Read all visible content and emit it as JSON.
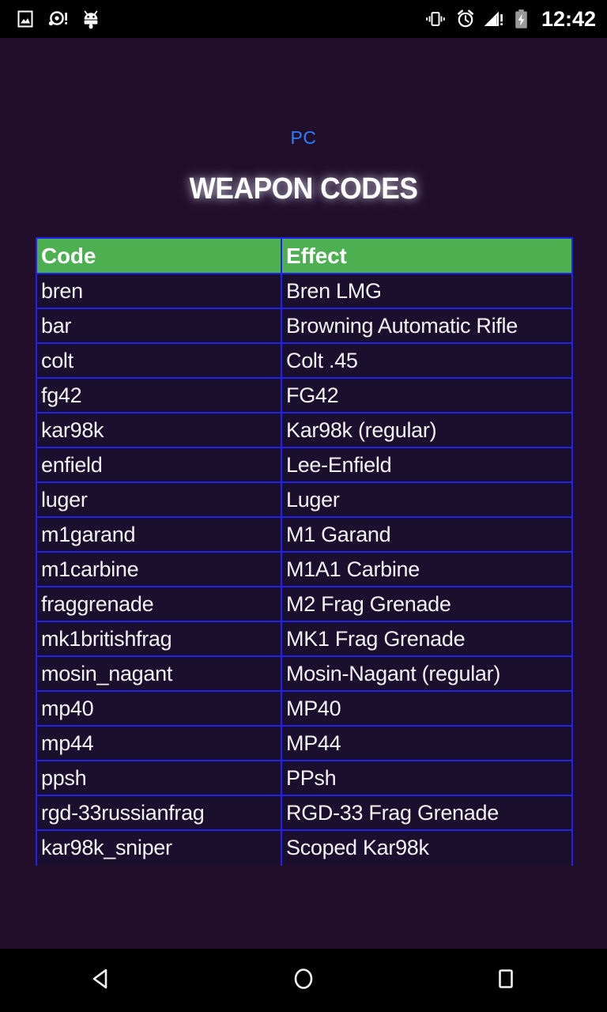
{
  "status_bar": {
    "left_icons": [
      {
        "name": "image-gallery-icon",
        "glyph": "picture"
      },
      {
        "name": "disc-alert-icon",
        "glyph": "disc-exclaim"
      },
      {
        "name": "android-robot-icon",
        "glyph": "android"
      }
    ],
    "right_icons": [
      {
        "name": "vibrate-icon",
        "glyph": "vibrate"
      },
      {
        "name": "alarm-clock-icon",
        "glyph": "alarm"
      },
      {
        "name": "signal-alert-icon",
        "glyph": "signal-exclaim"
      },
      {
        "name": "battery-charging-icon",
        "glyph": "battery-charging"
      }
    ],
    "clock": "12:42"
  },
  "page": {
    "platform_link": "PC",
    "title": "WEAPON CODES",
    "background_color": "#210e2b",
    "link_color": "#2a7fff",
    "title_color": "#ffffff"
  },
  "table": {
    "header_background": "#4caf50",
    "border_color": "#2222ee",
    "cell_background": "#1b0f2e",
    "columns": [
      "Code",
      "Effect"
    ],
    "rows": [
      {
        "code": "bren",
        "effect": "Bren LMG"
      },
      {
        "code": "bar",
        "effect": "Browning Automatic Rifle"
      },
      {
        "code": "colt",
        "effect": "Colt .45"
      },
      {
        "code": "fg42",
        "effect": "FG42"
      },
      {
        "code": "kar98k",
        "effect": "Kar98k (regular)"
      },
      {
        "code": "enfield",
        "effect": "Lee-Enfield"
      },
      {
        "code": "luger",
        "effect": "Luger"
      },
      {
        "code": "m1garand",
        "effect": "M1 Garand"
      },
      {
        "code": "m1carbine",
        "effect": "M1A1 Carbine"
      },
      {
        "code": "fraggrenade",
        "effect": "M2 Frag Grenade"
      },
      {
        "code": "mk1britishfrag",
        "effect": "MK1 Frag Grenade"
      },
      {
        "code": "mosin_nagant",
        "effect": "Mosin-Nagant (regular)"
      },
      {
        "code": "mp40",
        "effect": "MP40"
      },
      {
        "code": "mp44",
        "effect": "MP44"
      },
      {
        "code": "ppsh",
        "effect": "PPsh"
      },
      {
        "code": "rgd-33russianfrag",
        "effect": "RGD-33 Frag Grenade"
      },
      {
        "code": "kar98k_sniper",
        "effect": "Scoped Kar98k"
      }
    ]
  },
  "nav_bar": {
    "back": "back-button",
    "home": "home-button",
    "recents": "recents-button"
  }
}
